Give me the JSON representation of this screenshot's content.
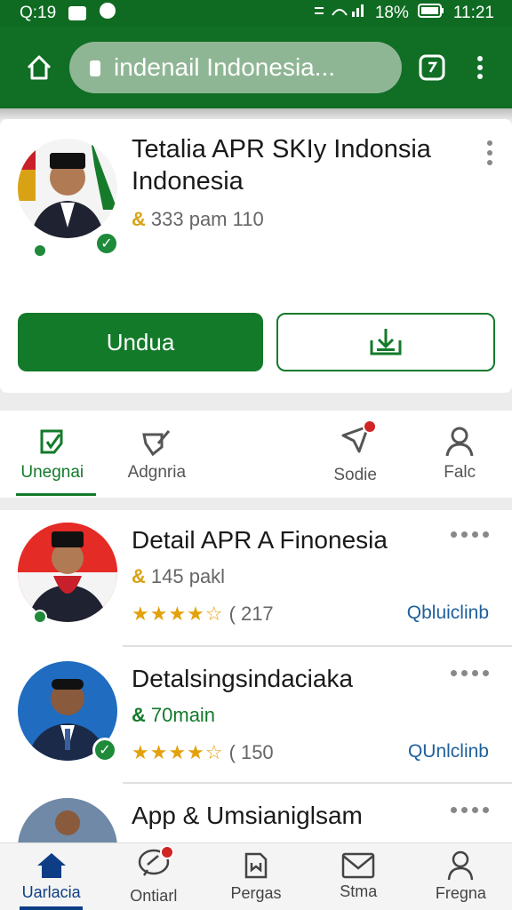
{
  "status": {
    "time_left": "Q:19",
    "battery": "18%",
    "time_right": "11:21"
  },
  "toolbar": {
    "url": "indenail Indonesia..."
  },
  "hero": {
    "title": "Tetalia APR SKIy Indonsia Indonesia",
    "meta": "333 pam 110",
    "primary_button": "Undua"
  },
  "tabs": [
    {
      "label": "Unegnai"
    },
    {
      "label": "Adgnria"
    },
    {
      "label": "Sodie"
    },
    {
      "label": "Falc"
    }
  ],
  "list": [
    {
      "title": "Detail APR A Finonesia",
      "meta": "145 pakl",
      "rating_count": "217",
      "link": "Qbluiclinb",
      "rating": 4.5
    },
    {
      "title": "Detalsingsindaciaka",
      "meta": "70main",
      "rating_count": "150",
      "link": "QUnlclinb",
      "rating": 4.5
    },
    {
      "title": "App & Umsianiglsam",
      "meta": "",
      "rating_count": "",
      "link": "",
      "rating": 0
    }
  ],
  "bottom_nav": [
    {
      "label": "Uarlacia"
    },
    {
      "label": "Ontiarl"
    },
    {
      "label": "Pergas"
    },
    {
      "label": "Stma"
    },
    {
      "label": "Fregna"
    }
  ],
  "colors": {
    "primary_green": "#116e25",
    "accent_blue": "#0d3e85",
    "star": "#e3a20c"
  }
}
